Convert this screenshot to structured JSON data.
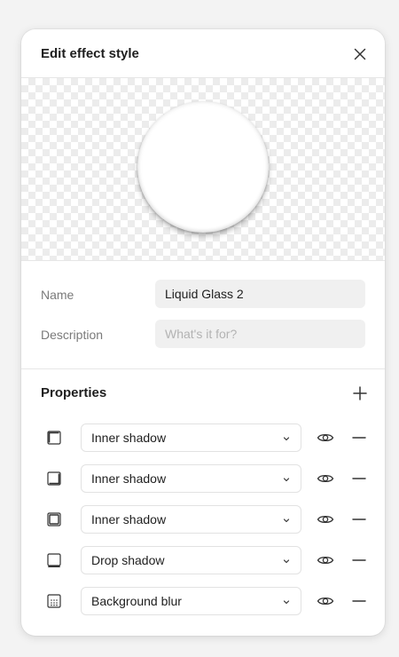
{
  "header": {
    "title": "Edit effect style",
    "close_icon": "close-icon"
  },
  "form": {
    "name_label": "Name",
    "name_value": "Liquid Glass 2",
    "description_label": "Description",
    "description_placeholder": "What's it for?"
  },
  "properties": {
    "title": "Properties",
    "add_icon": "plus-icon",
    "items": [
      {
        "type": "Inner shadow",
        "icon": "inner-shadow-icon"
      },
      {
        "type": "Inner shadow",
        "icon": "inner-shadow-icon"
      },
      {
        "type": "Inner shadow",
        "icon": "inner-shadow-icon"
      },
      {
        "type": "Drop shadow",
        "icon": "drop-shadow-icon"
      },
      {
        "type": "Background blur",
        "icon": "background-blur-icon"
      }
    ]
  },
  "colors": {
    "panel_bg": "#ffffff",
    "input_bg": "#f0f0f0",
    "text": "#1e1e1e",
    "muted": "#7a7a7a"
  }
}
